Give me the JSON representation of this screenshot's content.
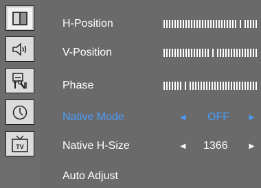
{
  "sidebar": {
    "tabs": [
      {
        "icon": "picture-icon",
        "active": true
      },
      {
        "icon": "speaker-icon",
        "active": false
      },
      {
        "icon": "setup-tools-icon",
        "active": false
      },
      {
        "icon": "clock-icon",
        "active": false
      },
      {
        "icon": "tv-icon",
        "active": false
      }
    ]
  },
  "menu": {
    "h_position": {
      "label": "H-Position",
      "level": 0.84
    },
    "v_position": {
      "label": "V-Position",
      "level": 0.54
    },
    "phase": {
      "label": "Phase",
      "level": 0.22
    },
    "native_mode": {
      "label": "Native Mode",
      "value": "OFF",
      "left_arrow": "◄",
      "right_arrow": "►"
    },
    "native_h_size": {
      "label": "Native H-Size",
      "value": "1366",
      "left_arrow": "◄",
      "right_arrow": "►"
    },
    "auto_adjust": {
      "label": "Auto Adjust"
    }
  },
  "colors": {
    "background": "#6a6a6a",
    "text": "#ffffff",
    "highlight": "#4a9dff"
  }
}
